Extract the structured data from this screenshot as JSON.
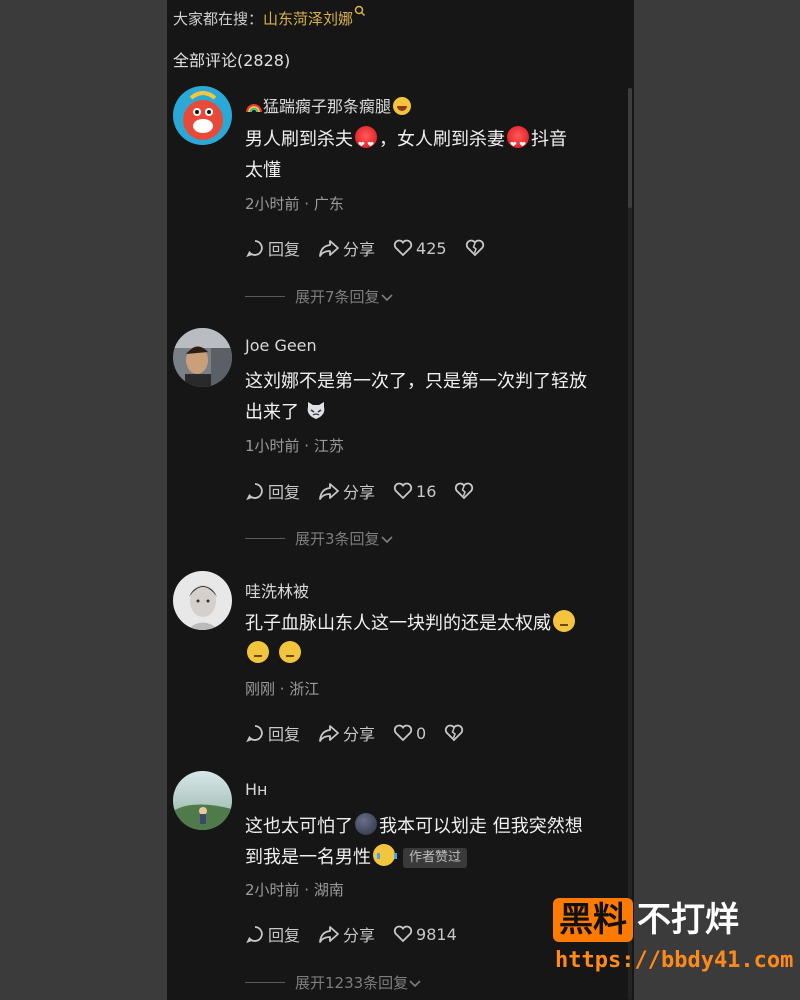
{
  "search": {
    "prefix": "大家都在搜：",
    "term": "山东菏泽刘娜"
  },
  "total_label": "全部评论(2828)",
  "comments": [
    {
      "username": "猛踹瘸子那条瘸腿",
      "text_parts": [
        "男人刷到杀夫",
        "，女人刷到杀妻",
        "抖音",
        "太懂"
      ],
      "meta": "2小时前 · 广东",
      "reply_label": "回复",
      "share_label": "分享",
      "likes": "425",
      "expand_label": "展开7条回复"
    },
    {
      "username": "Joe Geen",
      "text_parts": [
        "这刘娜不是第一次了，只是第一次判了轻放",
        "出来了"
      ],
      "meta": "1小时前 · 江苏",
      "reply_label": "回复",
      "share_label": "分享",
      "likes": "16",
      "expand_label": "展开3条回复"
    },
    {
      "username": "哇洗林被",
      "text_parts": [
        "孔子血脉山东人这一块判的还是太权威"
      ],
      "meta": "刚刚 · 浙江",
      "reply_label": "回复",
      "share_label": "分享",
      "likes": "0"
    },
    {
      "username": "Hн",
      "text_parts": [
        "这也太可怕了",
        "我本可以划走 但我突然想",
        "到我是一名男性"
      ],
      "badge": "作者赞过",
      "meta": "2小时前 · 湖南",
      "reply_label": "回复",
      "share_label": "分享",
      "likes": "9814",
      "expand_label": "展开1233条回复"
    }
  ],
  "watermark": {
    "box": "黑料",
    "rest": "不打烊",
    "url": "https://bbdy41.com"
  },
  "colors": {
    "panel_bg": "#161616",
    "search_term": "#d9b34a",
    "watermark_orange": "#ff7a00",
    "side_bg": "#3b3b3b"
  }
}
